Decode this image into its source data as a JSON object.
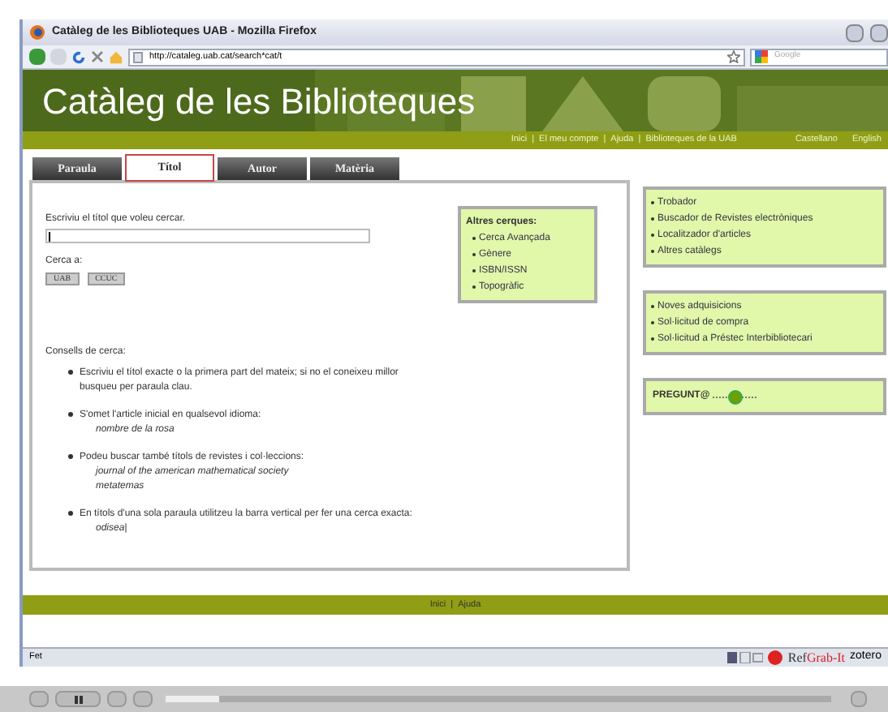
{
  "window": {
    "title": "Catàleg de les Biblioteques UAB - Mozilla Firefox"
  },
  "toolbar": {
    "url": "http://cataleg.uab.cat/search*cat/t",
    "search_placeholder": "Google"
  },
  "banner": {
    "title": "Catàleg de les Biblioteques"
  },
  "top_links": [
    "Inici",
    "|",
    "El meu compte",
    "|",
    "Ajuda",
    "|",
    "Biblioteques de la UAB"
  ],
  "language_links": [
    "Castellano",
    "English"
  ],
  "tabs": [
    {
      "label": "Paraula",
      "selected": false
    },
    {
      "label": "Títol",
      "selected": true
    },
    {
      "label": "Autor",
      "selected": false
    },
    {
      "label": "Matèria",
      "selected": false
    }
  ],
  "search": {
    "prompt": "Escriviu el títol que voleu cercar.",
    "search_in_label": "Cerca a:",
    "buttons": [
      "UAB",
      "CCUC"
    ]
  },
  "other_searches": {
    "title": "Altres cerques:",
    "items": [
      "Cerca Avançada",
      "Gènere",
      "ISBN/ISSN",
      "Topogràfic"
    ]
  },
  "tips": {
    "title": "Consells de cerca:",
    "items": [
      {
        "text": "Escriviu el títol exacte o la primera part del mateix; si no el coneixeu millor busqueu per paraula clau."
      },
      {
        "text": "S'omet l'article inicial en qualsevol idioma:",
        "examples": [
          "nombre de la rosa"
        ]
      },
      {
        "text": "Podeu buscar també títols de revistes i col·leccions:",
        "examples": [
          "journal of the american mathematical society",
          "metatemas"
        ]
      },
      {
        "text": "En títols d'una sola paraula utilitzeu la barra vertical per fer una cerca exacta:",
        "examples": [
          "odisea|"
        ]
      }
    ]
  },
  "side_boxes": [
    {
      "items": [
        "Trobador",
        "Buscador de Revistes electròniques",
        "Localitzador d'articles",
        "Altres catàlegs"
      ]
    },
    {
      "items": [
        "Noves adquisicions",
        "Sol·licitud de compra",
        "Sol·licitud a Préstec Interbibliotecari"
      ]
    }
  ],
  "pregunta": {
    "label": "PREGUNT@"
  },
  "footer_links": [
    "Inici",
    "|",
    "Ajuda"
  ],
  "status_bar": {
    "text": "Fet",
    "refgrab_ref": "Ref",
    "refgrab_grab": "Grab-It",
    "zotero": "zotero"
  },
  "player": {
    "level": 0.08
  }
}
